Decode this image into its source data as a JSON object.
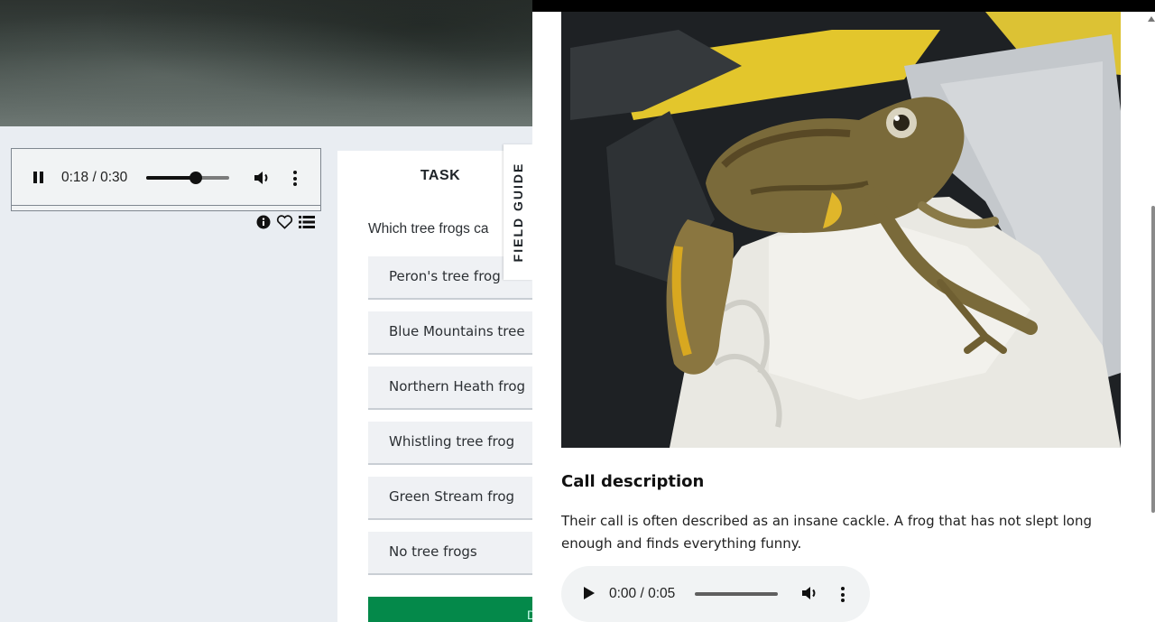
{
  "audio_player": {
    "time_display": "0:18 / 0:30",
    "progress_fraction": 0.6,
    "state": "playing"
  },
  "toolbar_icons": [
    "info-icon",
    "heart-icon",
    "list-icon"
  ],
  "task": {
    "title": "TASK",
    "question": "Which tree frogs ca",
    "options": [
      "Peron's tree frog",
      "Blue Mountains tree",
      "Northern Heath frog",
      "Whistling tree frog",
      "Green Stream frog",
      "No tree frogs"
    ],
    "done_label": "D"
  },
  "field_guide_tab": {
    "label": "FIELD GUIDE"
  },
  "field_guide": {
    "call_title": "Call description",
    "call_text": "Their call is often described as an insane cackle. A frog that has not slept long enough and finds everything funny.",
    "player": {
      "time_display": "0:00 / 0:05",
      "progress_fraction": 0
    }
  },
  "colors": {
    "accent_green": "#04894a",
    "panel_bg": "#e9edf2"
  }
}
